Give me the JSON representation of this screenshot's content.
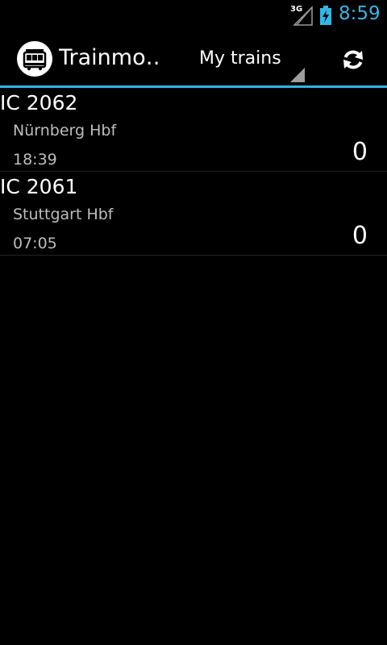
{
  "status_bar": {
    "network": "3G",
    "time": "8:59"
  },
  "action_bar": {
    "app_title": "Trainmo…",
    "spinner_value": "My trains",
    "icons": [
      "tram-icon",
      "refresh-icon"
    ]
  },
  "trains": [
    {
      "train": "IC 2062",
      "station": "Nürnberg Hbf",
      "time": "18:39",
      "count": "0"
    },
    {
      "train": "IC 2061",
      "station": "Stuttgart Hbf",
      "time": "07:05",
      "count": "0"
    }
  ],
  "colors": {
    "accent": "#33b5e5",
    "background": "#000000",
    "secondary_text": "#bdbdbd"
  }
}
